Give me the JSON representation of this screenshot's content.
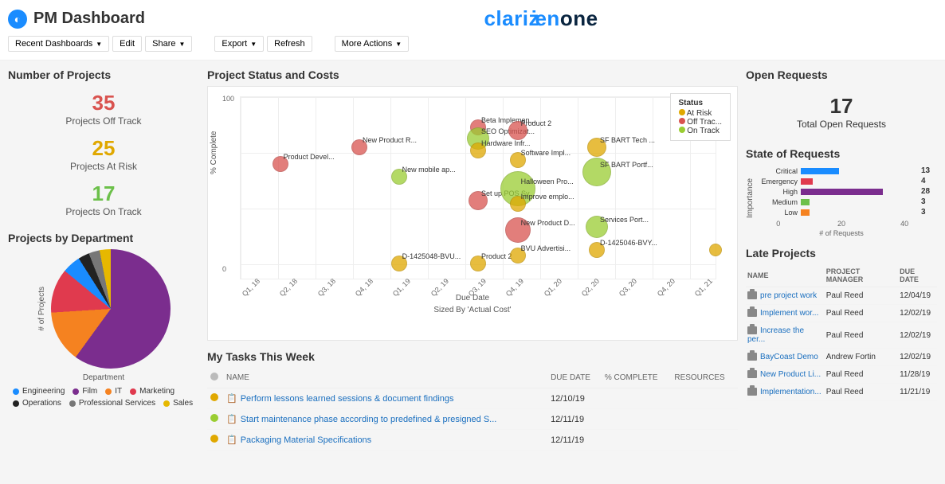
{
  "header": {
    "title": "PM Dashboard",
    "brand_part1": "clari",
    "brand_dot": "ż",
    "brand_part2": "en",
    "brand_part3": "one"
  },
  "toolbar": {
    "recent": "Recent Dashboards",
    "edit": "Edit",
    "share": "Share",
    "export": "Export",
    "refresh": "Refresh",
    "more": "More Actions"
  },
  "num_projects": {
    "title": "Number of Projects",
    "off": {
      "value": "35",
      "label": "Projects Off Track"
    },
    "risk": {
      "value": "25",
      "label": "Projects At Risk"
    },
    "on": {
      "value": "17",
      "label": "Projects On Track"
    }
  },
  "by_dept": {
    "title": "Projects by Department",
    "ylabel": "# of Projects",
    "xlabel": "Department",
    "legend": [
      {
        "name": "Engineering",
        "color": "#1a8cff"
      },
      {
        "name": "Film",
        "color": "#7b2d8e"
      },
      {
        "name": "IT",
        "color": "#f58220"
      },
      {
        "name": "Marketing",
        "color": "#e03a4e"
      },
      {
        "name": "Operations",
        "color": "#222"
      },
      {
        "name": "Professional Services",
        "color": "#777"
      },
      {
        "name": "Sales",
        "color": "#e6b800"
      }
    ]
  },
  "status_chart": {
    "title": "Project Status and Costs",
    "ylabel": "% Complete",
    "xlabel": "Due Date",
    "subtitle": "Sized By 'Actual Cost'",
    "yticks": [
      "0",
      "100"
    ],
    "xticks": [
      "Q1, 18",
      "Q2, 18",
      "Q3, 18",
      "Q4, 18",
      "Q1, 19",
      "Q2, 19",
      "Q3, 19",
      "Q4, 19",
      "Q1, 20",
      "Q2, 20",
      "Q3, 20",
      "Q4, 20",
      "Q1, 21"
    ],
    "legend": {
      "title": "Status",
      "items": [
        {
          "name": "At Risk",
          "color": "#e0a800"
        },
        {
          "name": "Off Trac...",
          "color": "#d9534f"
        },
        {
          "name": "On Track",
          "color": "#9acd32"
        }
      ]
    }
  },
  "tasks": {
    "title": "My Tasks This Week",
    "cols": [
      "NAME",
      "DUE DATE",
      "% COMPLETE",
      "RESOURCES"
    ],
    "rows": [
      {
        "status": "#e0a800",
        "name": "Perform lessons learned sessions & document findings",
        "due": "12/10/19"
      },
      {
        "status": "#9acd32",
        "name": "Start maintenance phase according to predefined & presigned S...",
        "due": "12/11/19"
      },
      {
        "status": "#e0a800",
        "name": "Packaging Material Specifications",
        "due": "12/11/19"
      }
    ]
  },
  "open_requests": {
    "title": "Open Requests",
    "value": "17",
    "label": "Total Open Requests"
  },
  "state_req": {
    "title": "State of Requests",
    "ylabel": "Importance",
    "xlabel": "# of Requests",
    "xticks": [
      "0",
      "20",
      "40"
    ],
    "rows": [
      {
        "name": "Critical",
        "color": "#1a8cff",
        "value": 13
      },
      {
        "name": "Emergency",
        "color": "#e03a4e",
        "value": 4
      },
      {
        "name": "High",
        "color": "#7b2d8e",
        "value": 28
      },
      {
        "name": "Medium",
        "color": "#6cc04a",
        "value": 3
      },
      {
        "name": "Low",
        "color": "#f58220",
        "value": 3
      }
    ]
  },
  "late": {
    "title": "Late Projects",
    "cols": [
      "NAME",
      "PROJECT MANAGER",
      "DUE DATE"
    ],
    "rows": [
      {
        "name": "pre project work",
        "pm": "Paul Reed",
        "due": "12/04/19"
      },
      {
        "name": "Implement wor...",
        "pm": "Paul Reed",
        "due": "12/02/19"
      },
      {
        "name": "Increase the per...",
        "pm": "Paul Reed",
        "due": "12/02/19"
      },
      {
        "name": "BayCoast Demo",
        "pm": "Andrew Fortin",
        "due": "12/02/19"
      },
      {
        "name": "New Product Li...",
        "pm": "Paul Reed",
        "due": "11/28/19"
      },
      {
        "name": "Implementation...",
        "pm": "Paul Reed",
        "due": "11/21/19"
      }
    ]
  },
  "chart_data": [
    {
      "type": "pie",
      "title": "Projects by Department",
      "series": [
        {
          "name": "slices",
          "values": [
            {
              "name": "Film",
              "value": 60,
              "color": "#7b2d8e"
            },
            {
              "name": "IT",
              "value": 14,
              "color": "#f58220"
            },
            {
              "name": "Marketing",
              "value": 12,
              "color": "#e03a4e"
            },
            {
              "name": "Engineering",
              "value": 5,
              "color": "#1a8cff"
            },
            {
              "name": "Operations",
              "value": 3,
              "color": "#222"
            },
            {
              "name": "Professional Services",
              "value": 3,
              "color": "#777"
            },
            {
              "name": "Sales",
              "value": 3,
              "color": "#e6b800"
            }
          ]
        }
      ]
    },
    {
      "type": "scatter",
      "title": "Project Status and Costs",
      "xlabel": "Due Date",
      "ylabel": "% Complete",
      "ylim": [
        0,
        110
      ],
      "size_by": "Actual Cost",
      "legend": [
        "At Risk",
        "Off Track",
        "On Track"
      ],
      "series": [
        {
          "name": "projects",
          "values": [
            {
              "label": "Product Devel...",
              "x": "Q2, 18",
              "y": 70,
              "status": "Off Track",
              "size": 10
            },
            {
              "label": "New Product R...",
              "x": "Q4, 18",
              "y": 80,
              "status": "Off Track",
              "size": 10
            },
            {
              "label": "D-1425048-BVU...",
              "x": "Q1, 19",
              "y": 10,
              "status": "At Risk",
              "size": 10
            },
            {
              "label": "New mobile ap...",
              "x": "Q1, 19",
              "y": 62,
              "status": "On Track",
              "size": 10
            },
            {
              "label": "Beta Implemen...",
              "x": "Q3, 19",
              "y": 92,
              "status": "Off Track",
              "size": 10
            },
            {
              "label": "SEO Optimizat...",
              "x": "Q3, 19",
              "y": 85,
              "status": "On Track",
              "size": 14
            },
            {
              "label": "Hardware Infr...",
              "x": "Q3, 19",
              "y": 78,
              "status": "At Risk",
              "size": 10
            },
            {
              "label": "Set up POS Sy...",
              "x": "Q3, 19",
              "y": 48,
              "status": "Off Track",
              "size": 12
            },
            {
              "label": "Product 2",
              "x": "Q3, 19",
              "y": 10,
              "status": "At Risk",
              "size": 10
            },
            {
              "label": "Product 2",
              "x": "Q4, 19",
              "y": 90,
              "status": "Off Track",
              "size": 12
            },
            {
              "label": "Software Impl...",
              "x": "Q4, 19",
              "y": 72,
              "status": "At Risk",
              "size": 10
            },
            {
              "label": "Halloween Pro...",
              "x": "Q4, 19",
              "y": 55,
              "status": "On Track",
              "size": 22
            },
            {
              "label": "Improve emplo...",
              "x": "Q4, 19",
              "y": 46,
              "status": "At Risk",
              "size": 10
            },
            {
              "label": "New Product D...",
              "x": "Q4, 19",
              "y": 30,
              "status": "Off Track",
              "size": 16
            },
            {
              "label": "BVU Advertisi...",
              "x": "Q4, 19",
              "y": 15,
              "status": "At Risk",
              "size": 10
            },
            {
              "label": "SF BART Tech ...",
              "x": "Q2, 20",
              "y": 80,
              "status": "At Risk",
              "size": 12
            },
            {
              "label": "SF BART Portf...",
              "x": "Q2, 20",
              "y": 65,
              "status": "On Track",
              "size": 18
            },
            {
              "label": "Services Port...",
              "x": "Q2, 20",
              "y": 32,
              "status": "On Track",
              "size": 14
            },
            {
              "label": "D-1425046-BVY...",
              "x": "Q2, 20",
              "y": 18,
              "status": "At Risk",
              "size": 10
            },
            {
              "label": "",
              "x": "Q1, 21",
              "y": 18,
              "status": "At Risk",
              "size": 8
            }
          ]
        }
      ]
    },
    {
      "type": "bar",
      "title": "State of Requests",
      "xlabel": "# of Requests",
      "ylabel": "Importance",
      "xlim": [
        0,
        40
      ],
      "categories": [
        "Critical",
        "Emergency",
        "High",
        "Medium",
        "Low"
      ],
      "values": [
        13,
        4,
        28,
        3,
        3
      ]
    }
  ]
}
